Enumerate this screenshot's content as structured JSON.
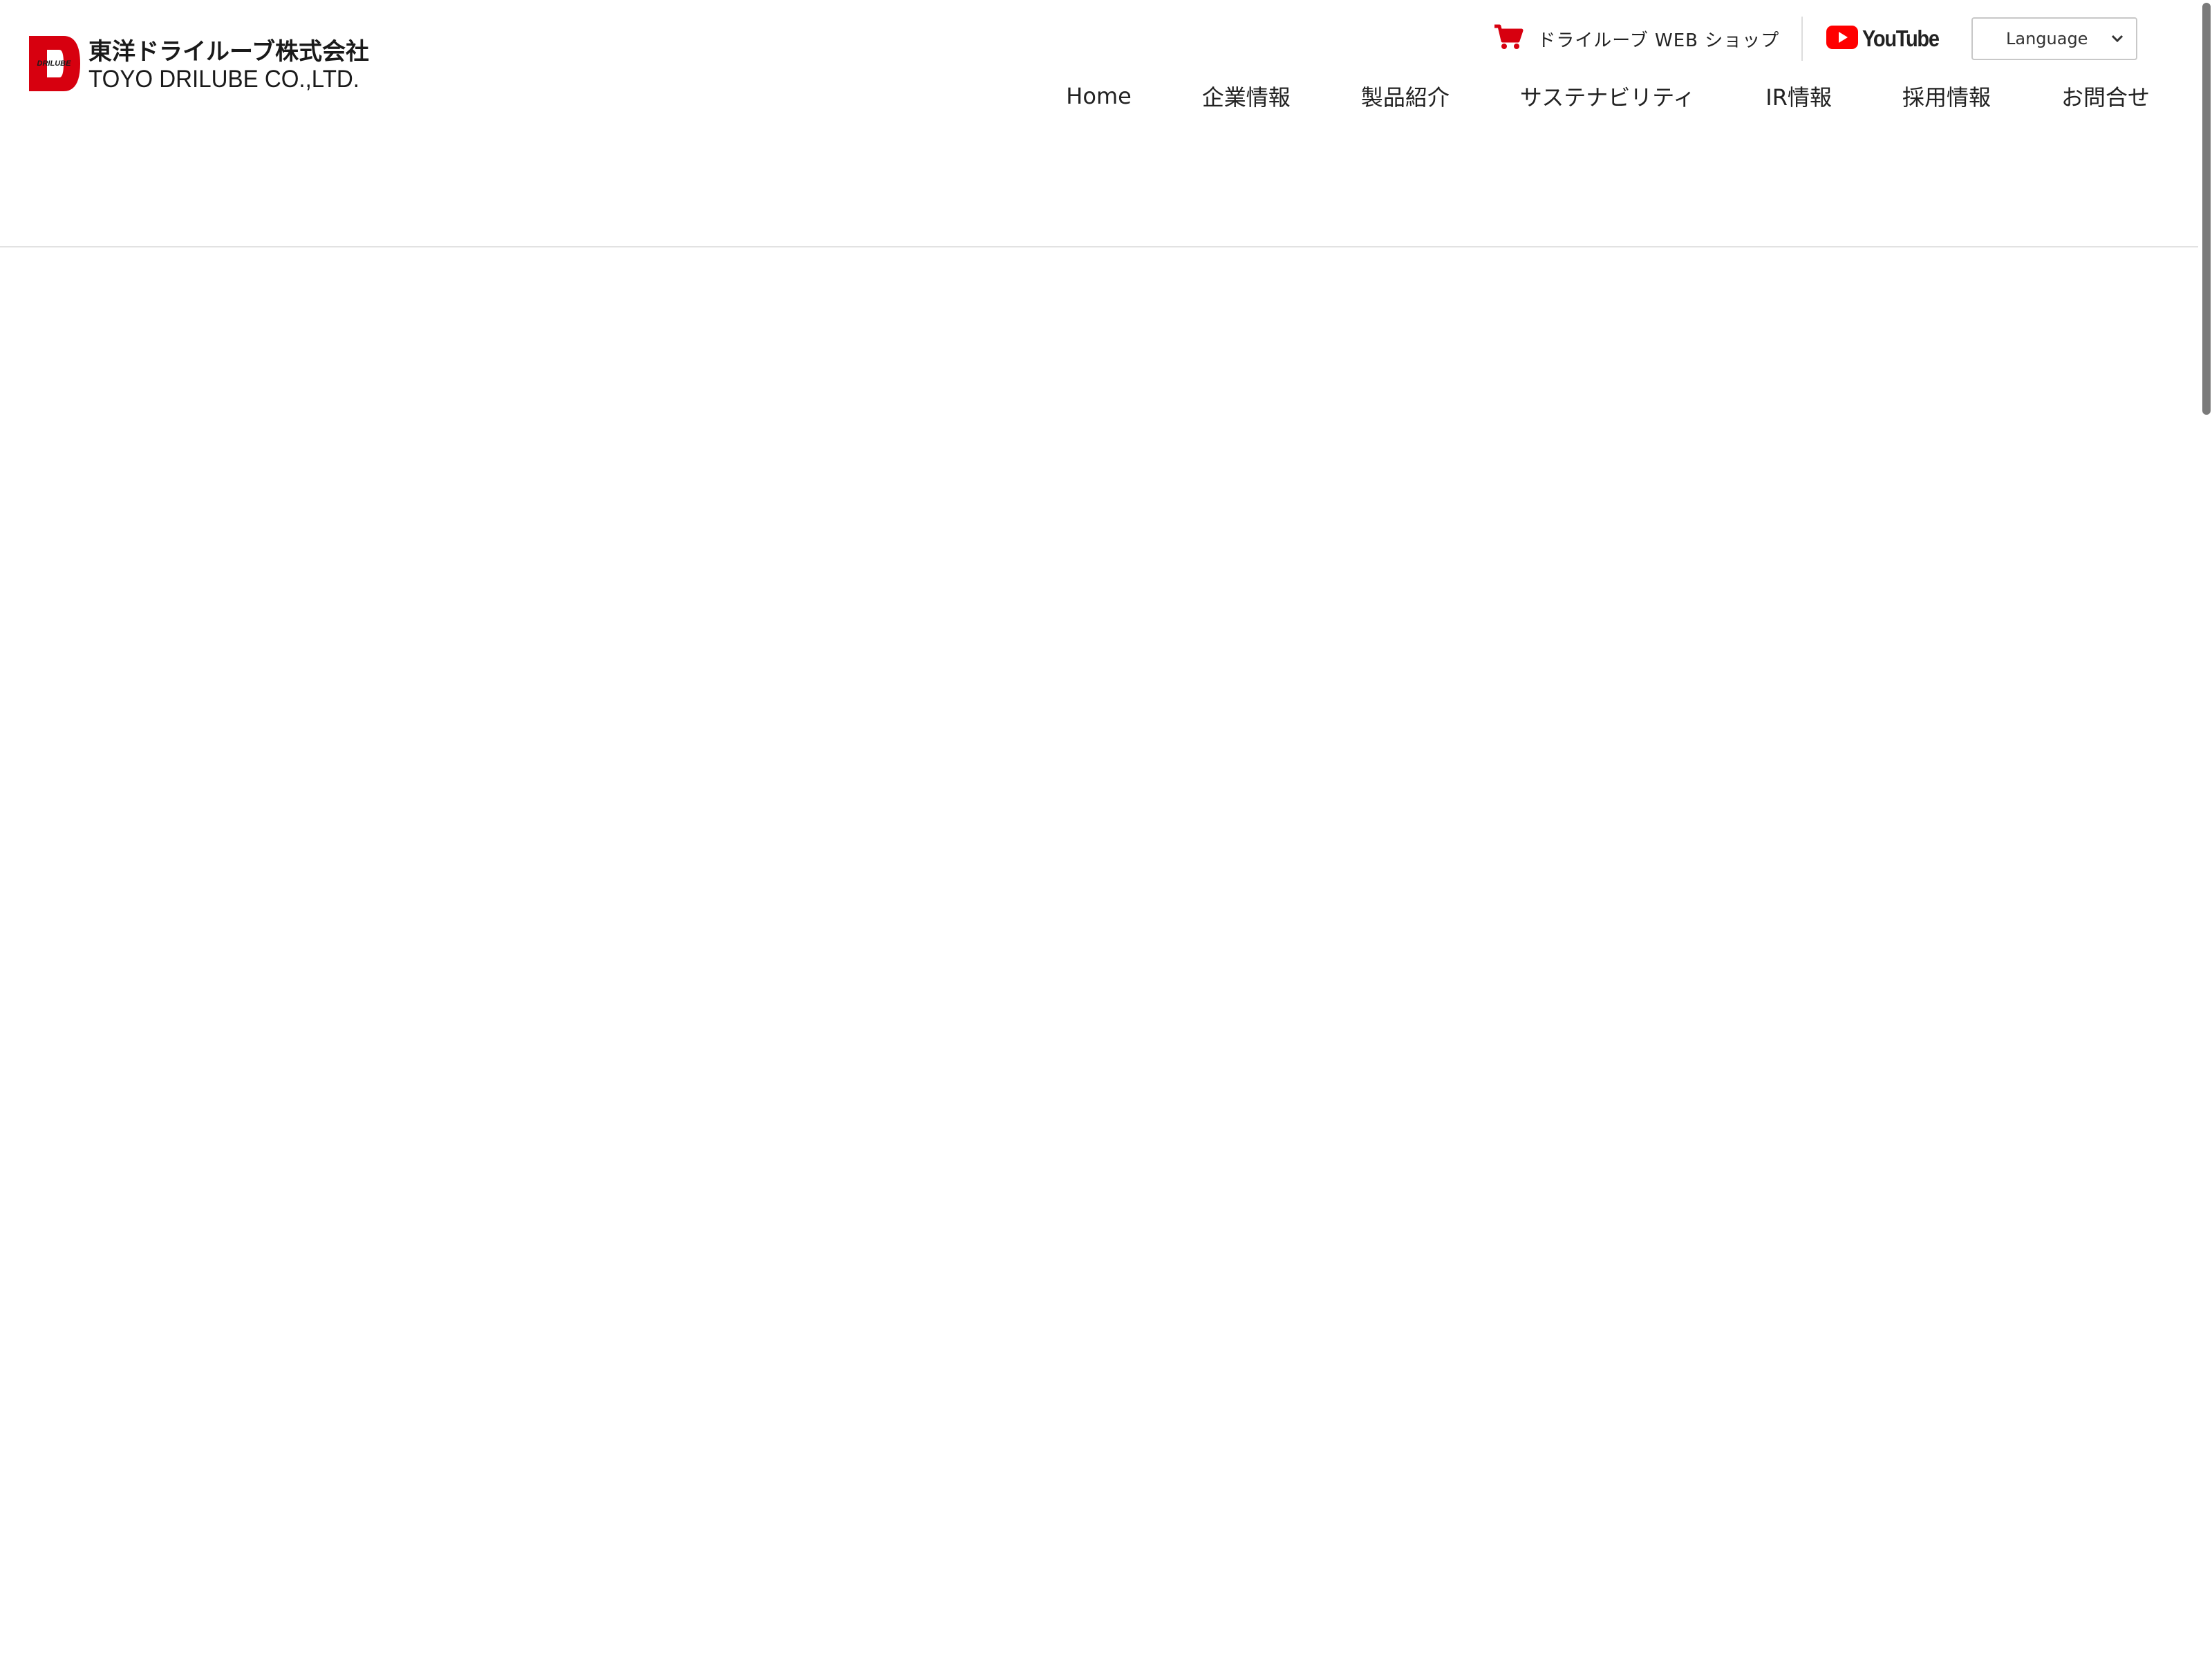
{
  "header": {
    "logo": {
      "mark_letter": "D",
      "mark_small_text": "DRILUBE",
      "jp_name": "東洋ドライルーブ株式会社",
      "en_name": "TOYO DRILUBE CO.,LTD."
    },
    "topbar": {
      "shop_label": "ドライルーブ WEB ショップ",
      "youtube_label": "YouTube",
      "language_label": "Language"
    },
    "nav": [
      {
        "label": "Home"
      },
      {
        "label": "企業情報"
      },
      {
        "label": "製品紹介"
      },
      {
        "label": "サステナビリティ"
      },
      {
        "label": "IR情報"
      },
      {
        "label": "採用情報"
      },
      {
        "label": "お問合せ"
      }
    ]
  },
  "colors": {
    "brand_red": "#d7000f",
    "youtube_red": "#ff0000",
    "text": "#222222",
    "border": "#c8c8c8"
  },
  "icons": {
    "cart": "cart-icon",
    "youtube": "youtube-play-icon",
    "dropdown": "chevron-down-icon"
  }
}
